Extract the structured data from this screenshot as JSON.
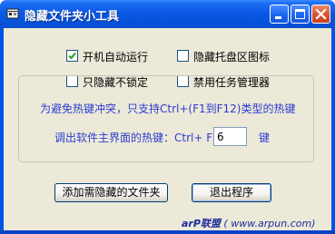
{
  "window": {
    "title": "隐藏文件夹小工具",
    "icon": "app-icon",
    "controls": [
      "minimize-icon",
      "maximize-icon",
      "close-icon"
    ]
  },
  "options": [
    {
      "label": "开机自动运行",
      "checked": true
    },
    {
      "label": "隐藏托盘区图标",
      "checked": false
    },
    {
      "label": "只隐藏不锁定",
      "checked": false
    },
    {
      "label": "禁用任务管理器",
      "checked": false
    }
  ],
  "hotkey": {
    "hint": "为避免热键冲突，只支持Ctrl+(F1到F12)类型的热键",
    "label": "调出软件主界面的热键：Ctrl+ F",
    "value": "6",
    "suffix": "键"
  },
  "buttons": {
    "add": "添加需隐藏的文件夹",
    "exit": "退出程序"
  },
  "footer": {
    "brand": "arP联盟",
    "url": "( www.arpun.com)"
  },
  "colors": {
    "title_bar": "#0054e3",
    "client_bg": "#ece9d8",
    "accent_text": "#2b3cd4",
    "close_button": "#d9532c"
  }
}
